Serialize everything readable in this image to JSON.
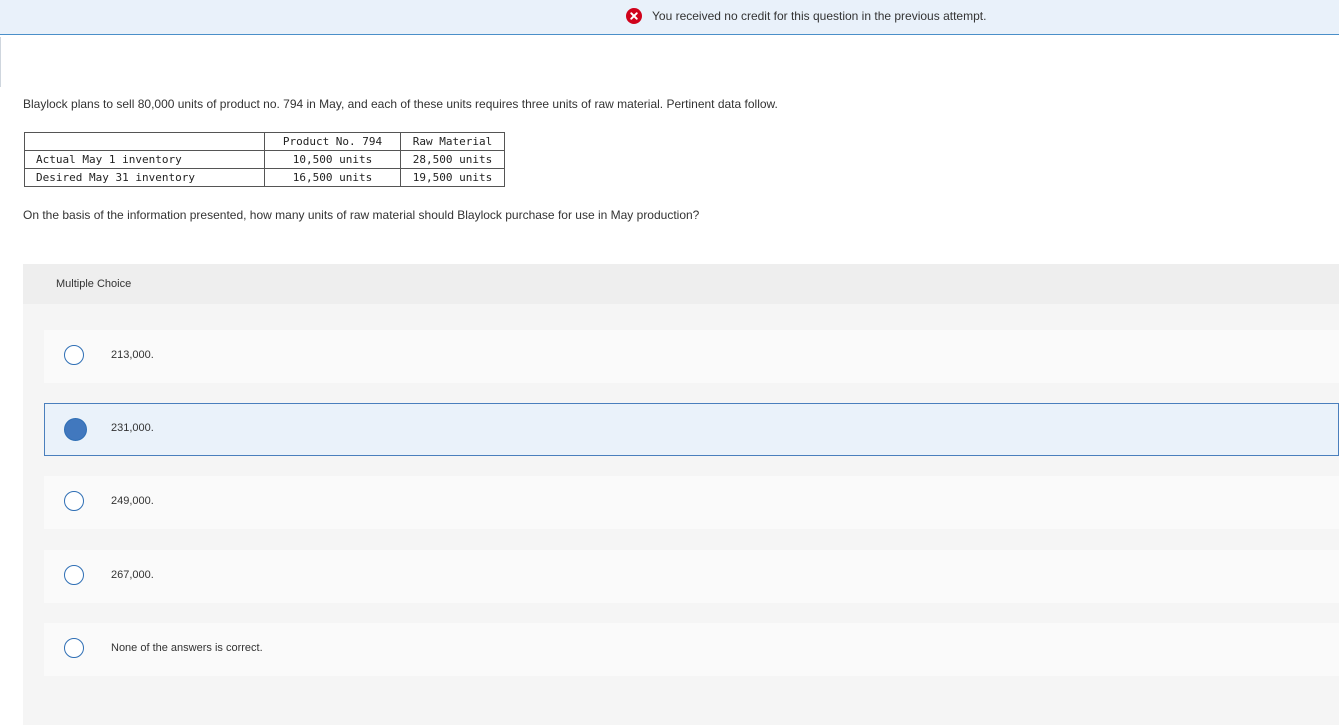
{
  "banner": {
    "message": "You received no credit for this question in the previous attempt.",
    "icon": "error-x-icon",
    "icon_color": "#d0021b"
  },
  "prompt": "Blaylock plans to sell 80,000 units of product no. 794 in May, and each of these units requires three units of raw material. Pertinent data follow.",
  "table": {
    "headers": [
      "",
      "Product No. 794",
      "Raw Material"
    ],
    "rows": [
      {
        "label": "Actual May 1 inventory",
        "product": "10,500 units",
        "raw": "28,500 units"
      },
      {
        "label": "Desired May 31 inventory",
        "product": "16,500 units",
        "raw": "19,500 units"
      }
    ]
  },
  "question": "On the basis of the information presented, how many units of raw material should Blaylock purchase for use in May production?",
  "multiple_choice": {
    "label": "Multiple Choice",
    "options": [
      {
        "text": "213,000.",
        "selected": false
      },
      {
        "text": "231,000.",
        "selected": true
      },
      {
        "text": "249,000.",
        "selected": false
      },
      {
        "text": "267,000.",
        "selected": false
      },
      {
        "text": "None of the answers is correct.",
        "selected": false
      }
    ],
    "accent_color": "#4178be"
  }
}
